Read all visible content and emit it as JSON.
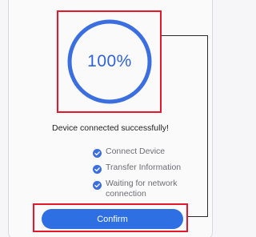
{
  "progress": {
    "percent_label": "100%",
    "value": 1.0,
    "ring_color": "#3b6fe0"
  },
  "status": {
    "message": "Device connected successfully!"
  },
  "steps": [
    {
      "label": "Connect Device",
      "icon": "check-circle-icon",
      "done": true
    },
    {
      "label": "Transfer Information",
      "icon": "check-circle-icon",
      "done": true
    },
    {
      "label": "Waiting for network connection",
      "icon": "check-circle-icon",
      "done": true
    }
  ],
  "confirm_button": {
    "label": "Confirm",
    "color": "#2f6fe4"
  },
  "annotation": {
    "highlight_color": "#e3192b"
  }
}
